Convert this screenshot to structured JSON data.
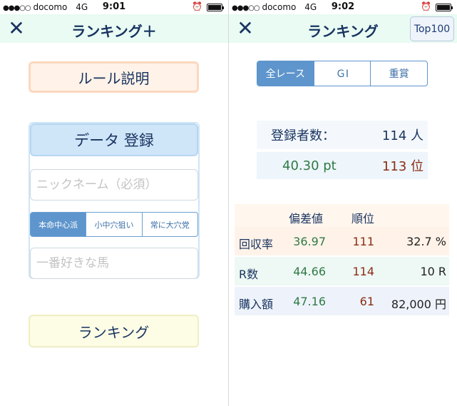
{
  "left": {
    "status": {
      "carrier_dots": "●●●○○",
      "carrier": "docomo",
      "network": "4G",
      "time": "9:01",
      "alarm_icon": "alarm-icon",
      "battery_level": 1.0
    },
    "nav": {
      "close_label": "✕",
      "title": "ランキング＋"
    },
    "rule_button": "ルール説明",
    "register_button": "データ 登録",
    "nickname_placeholder": "ニックネーム（必須）",
    "style_options": [
      "本命中心派",
      "小中穴狙い",
      "常に大穴党"
    ],
    "style_selected": "本命中心派",
    "horse_placeholder": "一番好きな馬",
    "ranking_button": "ランキング"
  },
  "right": {
    "status": {
      "carrier_dots": "●●●○○",
      "carrier": "docomo",
      "network": "4G",
      "time": "9:02",
      "alarm_icon": "alarm-icon",
      "battery_level": 1.0
    },
    "nav": {
      "close_label": "✕",
      "title": "ランキング",
      "top100_label": "Top100"
    },
    "race_tabs": [
      "全レース",
      "ＧⅠ",
      "重賞"
    ],
    "race_tab_selected": "全レース",
    "summary": {
      "registered_label": "登録者数：",
      "registered_value": "114 人",
      "points": "40.30 pt",
      "rank": "113 位"
    },
    "stats": {
      "headers": {
        "deviation": "偏差値",
        "rank": "順位"
      },
      "rows": [
        {
          "name": "回収率",
          "deviation": "36.97",
          "rank": "111",
          "amount": "32.7 %"
        },
        {
          "name": "R数",
          "deviation": "44.66",
          "rank": "114",
          "amount": "10 R"
        },
        {
          "name": "購入額",
          "deviation": "47.16",
          "rank": "61",
          "amount": "82,000 円"
        }
      ]
    }
  }
}
